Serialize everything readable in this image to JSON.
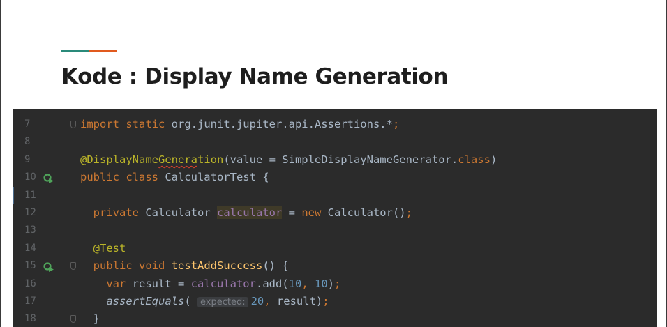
{
  "slide": {
    "title": "Kode : Display Name Generation",
    "accent_colors": [
      "#2a8a7a",
      "#e15a1e"
    ]
  },
  "editor": {
    "theme": "darcula",
    "line_numbers": [
      "7",
      "8",
      "9",
      "10",
      "11",
      "12",
      "13",
      "14",
      "15",
      "16",
      "17",
      "18"
    ],
    "gutter_icons": {
      "10": "run-test-icon",
      "15": "run-test-icon"
    },
    "inlay_hint": "expected:",
    "lines": [
      {
        "n": "7",
        "tokens": [
          [
            "kw",
            "import static"
          ],
          [
            "p",
            " org.junit.jupiter.api.Assertions."
          ],
          [
            "p",
            "*"
          ],
          [
            "kw",
            ";"
          ]
        ]
      },
      {
        "n": "8",
        "tokens": []
      },
      {
        "n": "9",
        "tokens": [
          [
            "ann",
            "@DisplayNameGeneration"
          ],
          [
            "p",
            "(value = SimpleDisplayNameGenerator."
          ],
          [
            "kw",
            "class"
          ],
          [
            "p",
            ")"
          ]
        ]
      },
      {
        "n": "10",
        "tokens": [
          [
            "kw",
            "public class"
          ],
          [
            "p",
            " CalculatorTest {"
          ]
        ]
      },
      {
        "n": "11",
        "tokens": []
      },
      {
        "n": "12",
        "tokens": [
          [
            "kw",
            "  private"
          ],
          [
            "p",
            " Calculator "
          ],
          [
            "fld",
            "calculator"
          ],
          [
            "p",
            " = "
          ],
          [
            "kw",
            "new"
          ],
          [
            "p",
            " Calculator()"
          ],
          [
            "kw",
            ";"
          ]
        ]
      },
      {
        "n": "13",
        "tokens": []
      },
      {
        "n": "14",
        "tokens": [
          [
            "ann",
            "  @Test"
          ]
        ]
      },
      {
        "n": "15",
        "tokens": [
          [
            "kw",
            "  public void"
          ],
          [
            "p",
            " "
          ],
          [
            "fn",
            "testAddSuccess"
          ],
          [
            "p",
            "() {"
          ]
        ]
      },
      {
        "n": "16",
        "tokens": [
          [
            "kw",
            "    var"
          ],
          [
            "p",
            " result = "
          ],
          [
            "fld",
            "calculator"
          ],
          [
            "p",
            ".add("
          ],
          [
            "num",
            "10"
          ],
          [
            "kw",
            ","
          ],
          [
            "p",
            " "
          ],
          [
            "num",
            "10"
          ],
          [
            "p",
            ")"
          ],
          [
            "kw",
            ";"
          ]
        ]
      },
      {
        "n": "17",
        "tokens": [
          [
            "it",
            "    assertEquals"
          ],
          [
            "p",
            "( "
          ],
          [
            "hint",
            "expected:"
          ],
          [
            "num",
            "20"
          ],
          [
            "kw",
            ","
          ],
          [
            "p",
            " result)"
          ],
          [
            "kw",
            ";"
          ]
        ]
      },
      {
        "n": "18",
        "tokens": [
          [
            "p",
            "  }"
          ]
        ]
      }
    ]
  }
}
